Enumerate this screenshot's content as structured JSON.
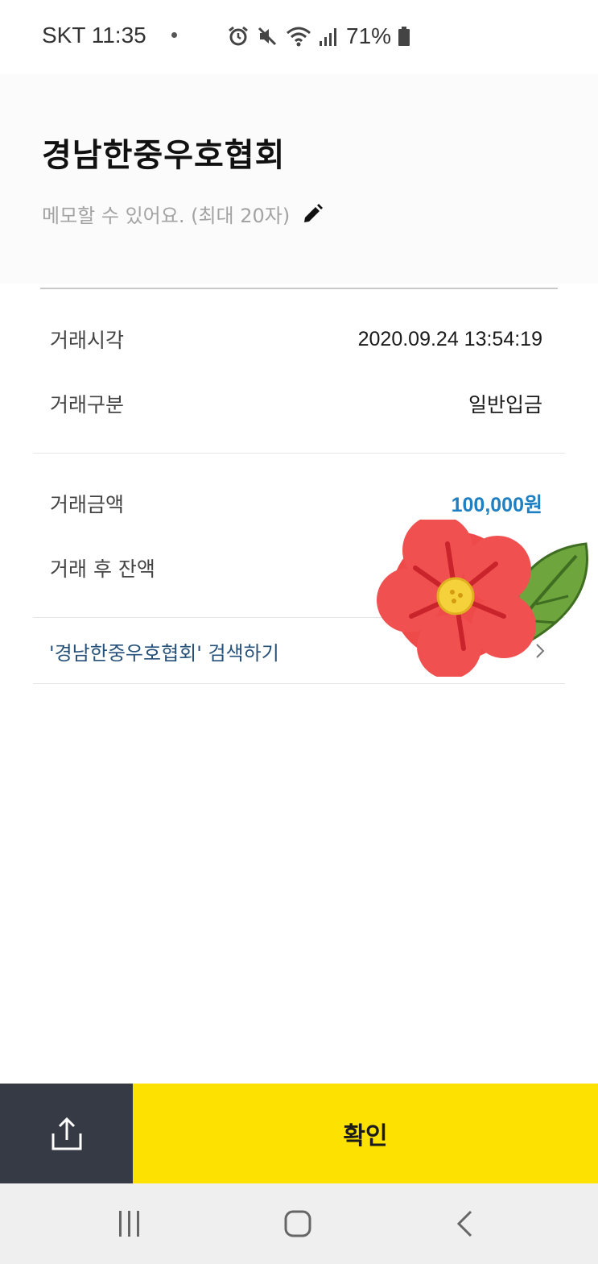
{
  "status_bar": {
    "carrier_time": "SKT 11:35",
    "battery": "71%",
    "icons": [
      "alarm-icon",
      "mute-icon",
      "wifi-icon",
      "signal-icon",
      "battery-icon"
    ]
  },
  "header": {
    "title": "경남한중우호협회",
    "memo_placeholder": "메모할 수 있어요. (최대 20자)",
    "edit_icon": "pencil-icon"
  },
  "details": [
    {
      "label": "거래시각",
      "value": "2020.09.24 13:54:19"
    },
    {
      "label": "거래구분",
      "value": "일반입금"
    },
    {
      "label": "거래금액",
      "value": "100,000원"
    },
    {
      "label": "거래 후 잔액",
      "value": ""
    }
  ],
  "search_link": {
    "text": "'경남한중우호협회' 검색하기",
    "icon": "chevron-right-icon"
  },
  "bottom_bar": {
    "share_icon": "share-icon",
    "confirm_label": "확인"
  },
  "nav_bar": {
    "icons": [
      "recent-apps-icon",
      "home-icon",
      "back-icon"
    ]
  },
  "colors": {
    "accent_yellow": "#fde100",
    "share_button": "#353a44",
    "amount_blue": "#1e7fc3",
    "link_blue": "#24507a"
  },
  "sticker": "flower-sticker"
}
